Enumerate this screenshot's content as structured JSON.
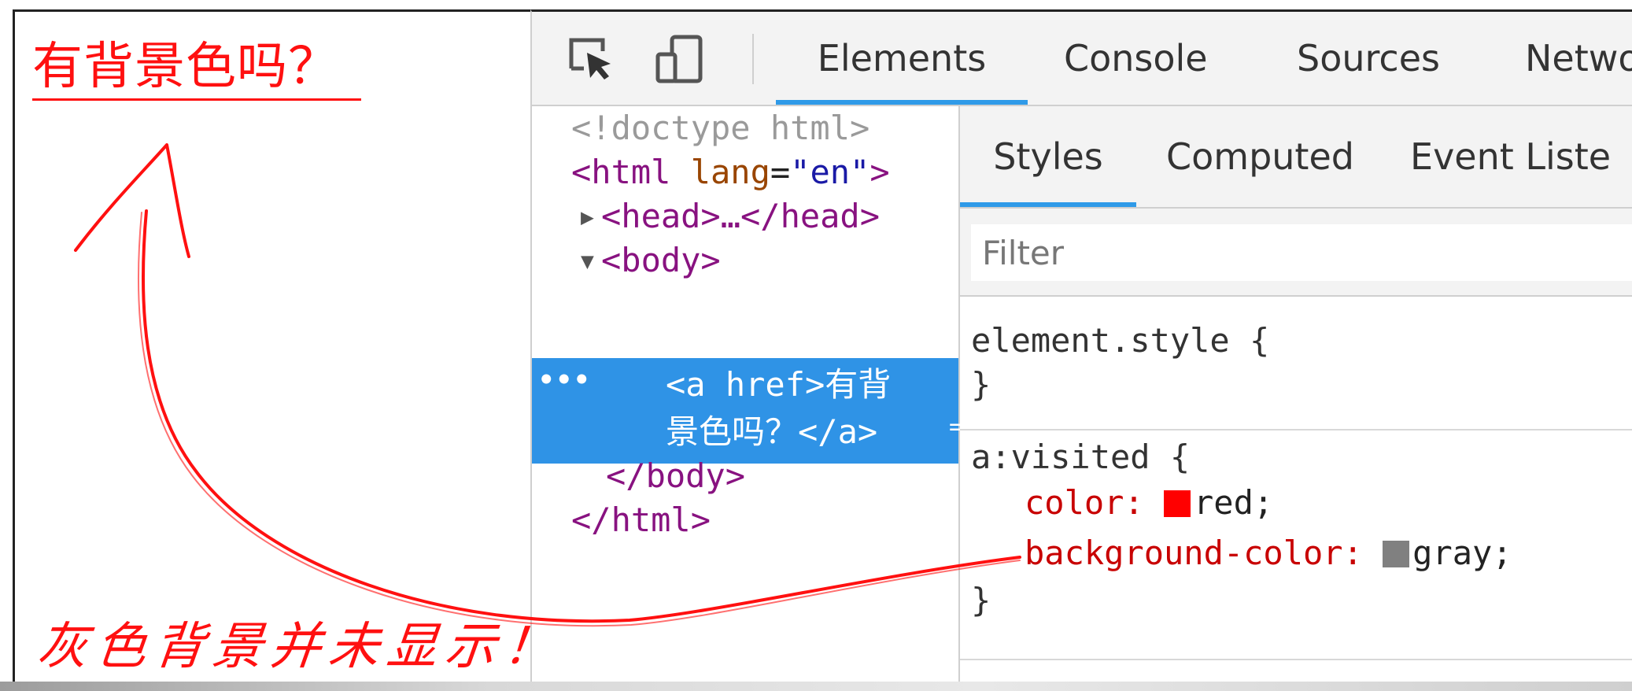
{
  "page_preview": {
    "link_text": "有背景色吗？",
    "annotation_note": "灰色背景并未显示！"
  },
  "devtools": {
    "toolbar": {
      "inspect_icon": "inspect-element-icon",
      "device_icon": "device-toolbar-icon",
      "tabs": [
        "Elements",
        "Console",
        "Sources",
        "Netwo"
      ],
      "active_tab": "Elements"
    },
    "dom_tree": {
      "doctype": "<!doctype html>",
      "html_open_tag": "<html",
      "html_attr_name": "lang",
      "html_attr_value": "\"en\"",
      "html_open_close": ">",
      "head": "<head>…</head>",
      "body_open": "<body>",
      "selected_dots": "•••",
      "selected_node": "<a href>有背\n景色吗？</a>",
      "selected_suffix": "=",
      "body_close": "</body>",
      "html_close": "</html>"
    },
    "styles_pane": {
      "tabs": [
        "Styles",
        "Computed",
        "Event Liste"
      ],
      "active_tab": "Styles",
      "filter_placeholder": "Filter",
      "rules": [
        {
          "selector": "element.style {",
          "close": "}"
        },
        {
          "selector": "a:visited {",
          "declarations": [
            {
              "property": "color:",
              "value": "red;",
              "swatch_color": "#ff0000"
            },
            {
              "property": "background-color:",
              "value": "gray;",
              "swatch_color": "#808080"
            }
          ],
          "close": "}"
        }
      ]
    },
    "colors": {
      "accent_blue": "#2f93e6",
      "annotation_red": "#ff1010"
    }
  }
}
